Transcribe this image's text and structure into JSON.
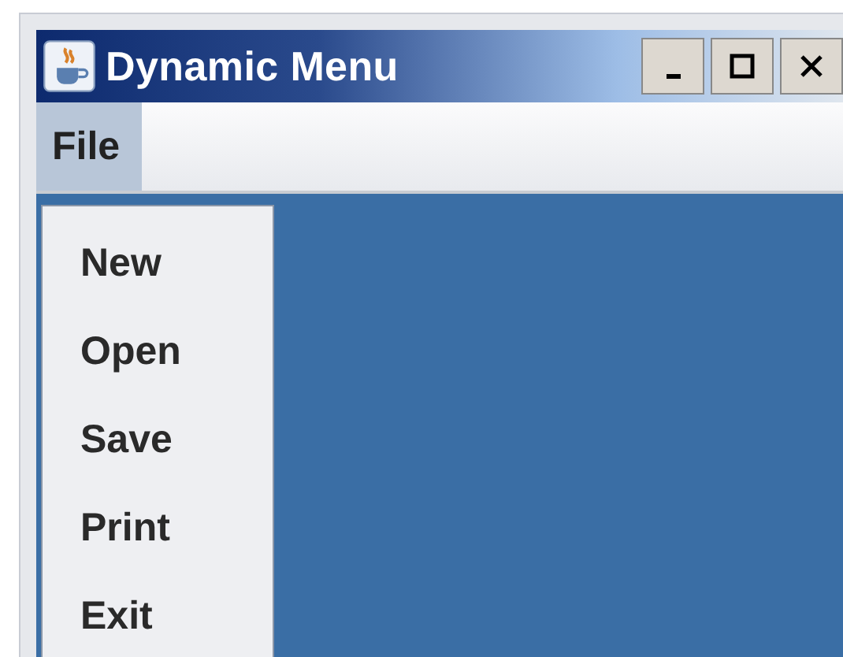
{
  "window": {
    "title": "Dynamic Menu"
  },
  "menu_bar": [
    {
      "label": "File",
      "selected": true
    }
  ],
  "open_menu": {
    "items": [
      "New",
      "Open",
      "Save",
      "Print",
      "Exit"
    ]
  }
}
